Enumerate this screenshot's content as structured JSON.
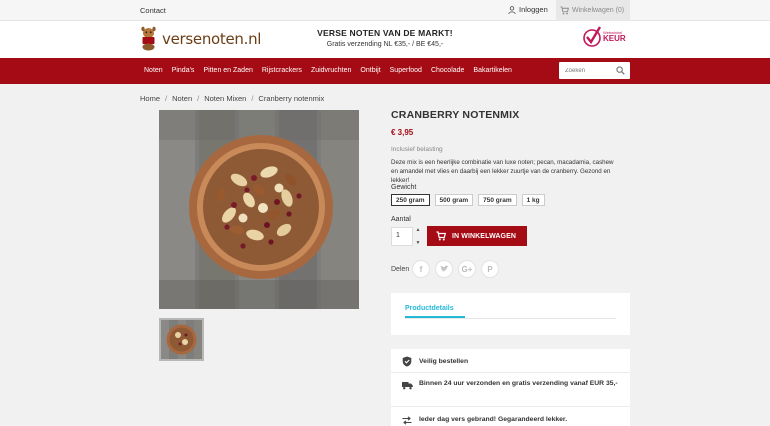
{
  "topbar": {
    "contact": "Contact",
    "login": "Inloggen",
    "cart": "Winkelwagen (0)"
  },
  "header": {
    "logo_text": "versenoten.nl",
    "promo_title": "VERSE NOTEN VAN DE MARKT!",
    "promo_sub": "Gratis verzending NL €35,- / BE €45,-",
    "keur_small": "Webwinkel",
    "keur_big": "KEUR"
  },
  "nav": {
    "items": [
      "Noten",
      "Pinda's",
      "Pitten en Zaden",
      "Rijstcrackers",
      "Zuidvruchten",
      "Ontbijt",
      "Superfood",
      "Chocolade",
      "Bakartikelen"
    ],
    "search_placeholder": "Zoeken"
  },
  "breadcrumb": [
    "Home",
    "Noten",
    "Noten Mixen",
    "Cranberry notenmix"
  ],
  "product": {
    "title": "CRANBERRY NOTENMIX",
    "price": "€ 3,95",
    "tax": "Inclusief belasting",
    "description": "Deze mix is een heerlijke combinatie van luxe noten; pecan, macadamia, cashew en amandel met vlies en daarbij een lekker zuurtje van de cranberry. Gezond en lekker!",
    "weight_label": "Gewicht",
    "variants": [
      "250 gram",
      "500 gram",
      "750 gram",
      "1 kg"
    ],
    "selected_variant": "250 gram",
    "qty_label": "Aantal",
    "qty_value": "1",
    "add_to_cart": "IN WINKELWAGEN",
    "share_label": "Delen"
  },
  "tabs": {
    "active": "Productdetails"
  },
  "reassurance": [
    "Veilig bestellen",
    "Binnen 24 uur verzonden en gratis verzending vanaf EUR 35,-",
    "Ieder dag vers gebrand! Gegarandeerd lekker."
  ],
  "colors": {
    "brand_red": "#a50b14",
    "accent_blue": "#24b9d7",
    "keur_pink": "#c2185b"
  }
}
